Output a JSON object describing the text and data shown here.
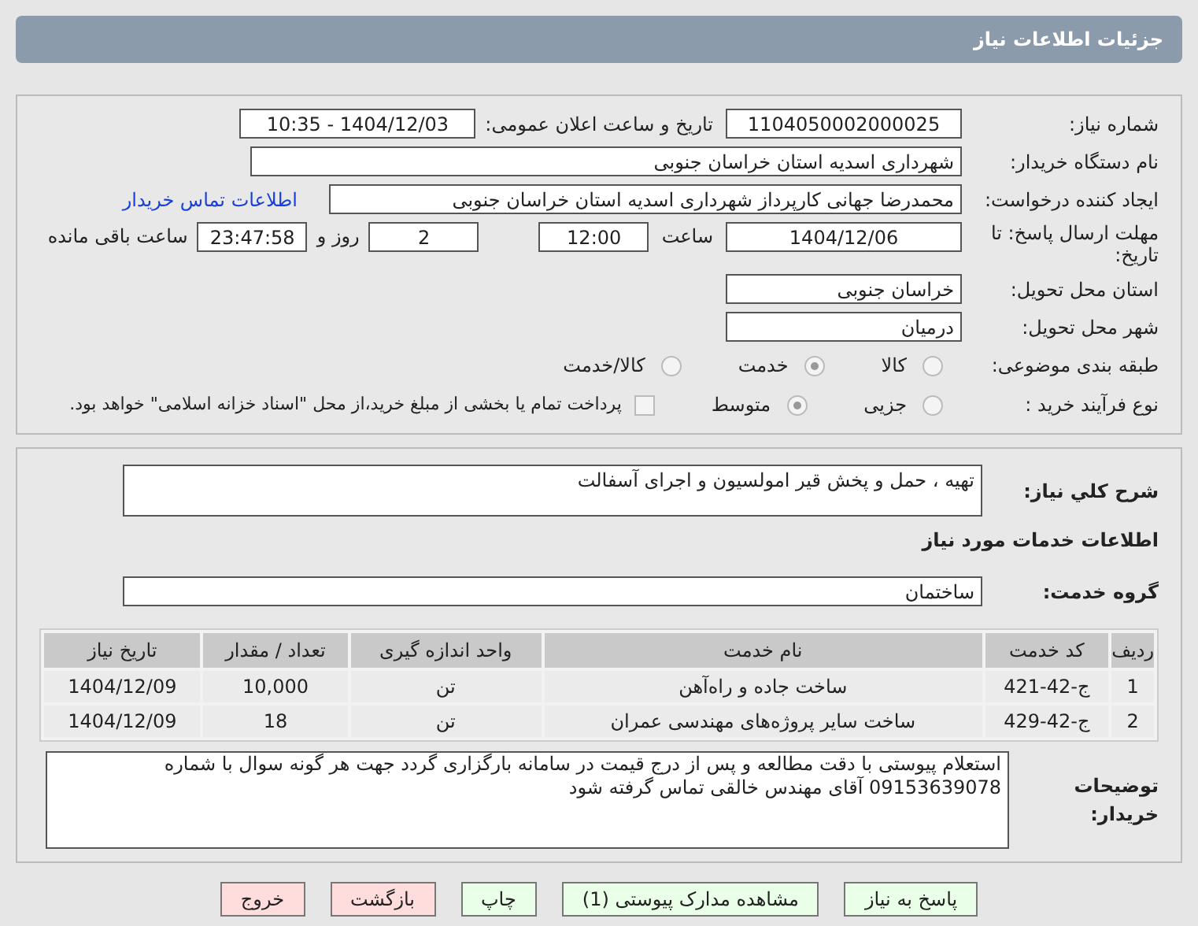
{
  "header": {
    "title": "جزئیات اطلاعات نیاز"
  },
  "need_number": {
    "label": "شماره نیاز:",
    "value": "1104050002000025"
  },
  "announce_date": {
    "label": "تاریخ و ساعت اعلان عمومی:",
    "value": "1404/12/03 - 10:35"
  },
  "buyer_org": {
    "label": "نام دستگاه خریدار:",
    "value": "شهرداری اسدیه استان خراسان جنوبی"
  },
  "requester": {
    "label": "ایجاد کننده درخواست:",
    "value": "محمدرضا جهانی کارپرداز شهرداری اسدیه استان خراسان جنوبی",
    "link": "اطلاعات تماس خریدار"
  },
  "deadline": {
    "label": "مهلت ارسال پاسخ: تا تاریخ:",
    "date": "1404/12/06",
    "time_label": "ساعت",
    "time": "12:00",
    "days": "2",
    "days_label": "روز و",
    "remaining": "23:47:58",
    "remaining_label": "ساعت باقی مانده"
  },
  "province": {
    "label": "استان محل تحویل:",
    "value": "خراسان جنوبی"
  },
  "city": {
    "label": "شهر محل تحویل:",
    "value": "درمیان"
  },
  "category": {
    "label": "طبقه بندی موضوعی:",
    "options": [
      {
        "label": "کالا",
        "selected": false
      },
      {
        "label": "خدمت",
        "selected": true
      },
      {
        "label": "کالا/خدمت",
        "selected": false
      }
    ]
  },
  "process": {
    "label": "نوع فرآیند خرید :",
    "options": [
      {
        "label": "جزیی",
        "selected": false
      },
      {
        "label": "متوسط",
        "selected": true
      }
    ],
    "payment": {
      "checked": false,
      "text": "پرداخت تمام یا بخشی از مبلغ خرید،از محل \"اسناد خزانه اسلامی\" خواهد بود."
    }
  },
  "summary": {
    "label": "شرح کلي نياز:",
    "value": "تهیه ، حمل و پخش قیر امولسیون و اجرای آسفالت"
  },
  "services_heading": "اطلاعات خدمات مورد نیاز",
  "service_group": {
    "label": "گروه خدمت:",
    "value": "ساختمان"
  },
  "table": {
    "columns": [
      "ردیف",
      "کد خدمت",
      "نام خدمت",
      "واحد اندازه گیری",
      "تعداد / مقدار",
      "تاریخ نیاز"
    ],
    "rows": [
      [
        "1",
        "ج-42-421",
        "ساخت جاده و راه‌آهن",
        "تن",
        "10,000",
        "1404/12/09"
      ],
      [
        "2",
        "ج-42-429",
        "ساخت سایر پروژه‌های مهندسی عمران",
        "تن",
        "18",
        "1404/12/09"
      ]
    ]
  },
  "notes": {
    "label": "توضیحات خریدار:",
    "value": "استعلام پیوستی با دقت مطالعه و پس از درج قیمت در سامانه بارگزاری گردد جهت هر گونه سوال با شماره 09153639078 آقای مهندس خالقی تماس گرفته شود"
  },
  "buttons": [
    {
      "label": "پاسخ به نیاز",
      "kind": "primary"
    },
    {
      "label": "مشاهده مدارک پیوستی (1)",
      "kind": "primary"
    },
    {
      "label": "چاپ",
      "kind": "primary"
    },
    {
      "label": "بازگشت",
      "kind": "danger"
    },
    {
      "label": "خروج",
      "kind": "danger"
    }
  ]
}
